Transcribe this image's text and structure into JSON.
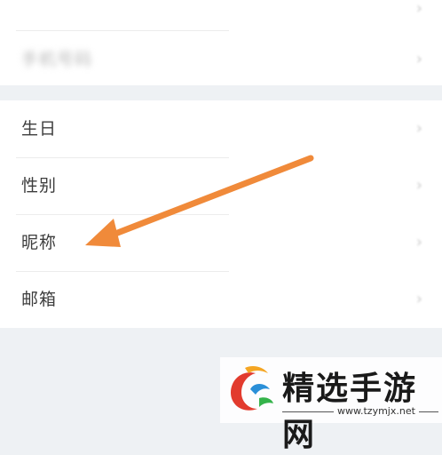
{
  "top_rows": [
    {
      "label": "",
      "value": "",
      "chevron": "›"
    },
    {
      "label": "手机号码",
      "value": "",
      "chevron": "›"
    }
  ],
  "profile_rows": [
    {
      "label": "生日",
      "value": "",
      "chevron": "›"
    },
    {
      "label": "性别",
      "value": "",
      "chevron": "›"
    },
    {
      "label": "昵称",
      "value": "",
      "chevron": "›"
    },
    {
      "label": "邮箱",
      "value": "",
      "chevron": "›"
    }
  ],
  "annotation": {
    "arrow_color": "#f08a3a",
    "icon": "arrow-annotation-icon"
  },
  "watermark": {
    "title": "精选手游网",
    "url": "www.tzymjx.net",
    "icon": "site-logo-icon",
    "logo_colors": [
      "#e23b2e",
      "#f5a623",
      "#2a8fd8",
      "#34b34a"
    ]
  }
}
